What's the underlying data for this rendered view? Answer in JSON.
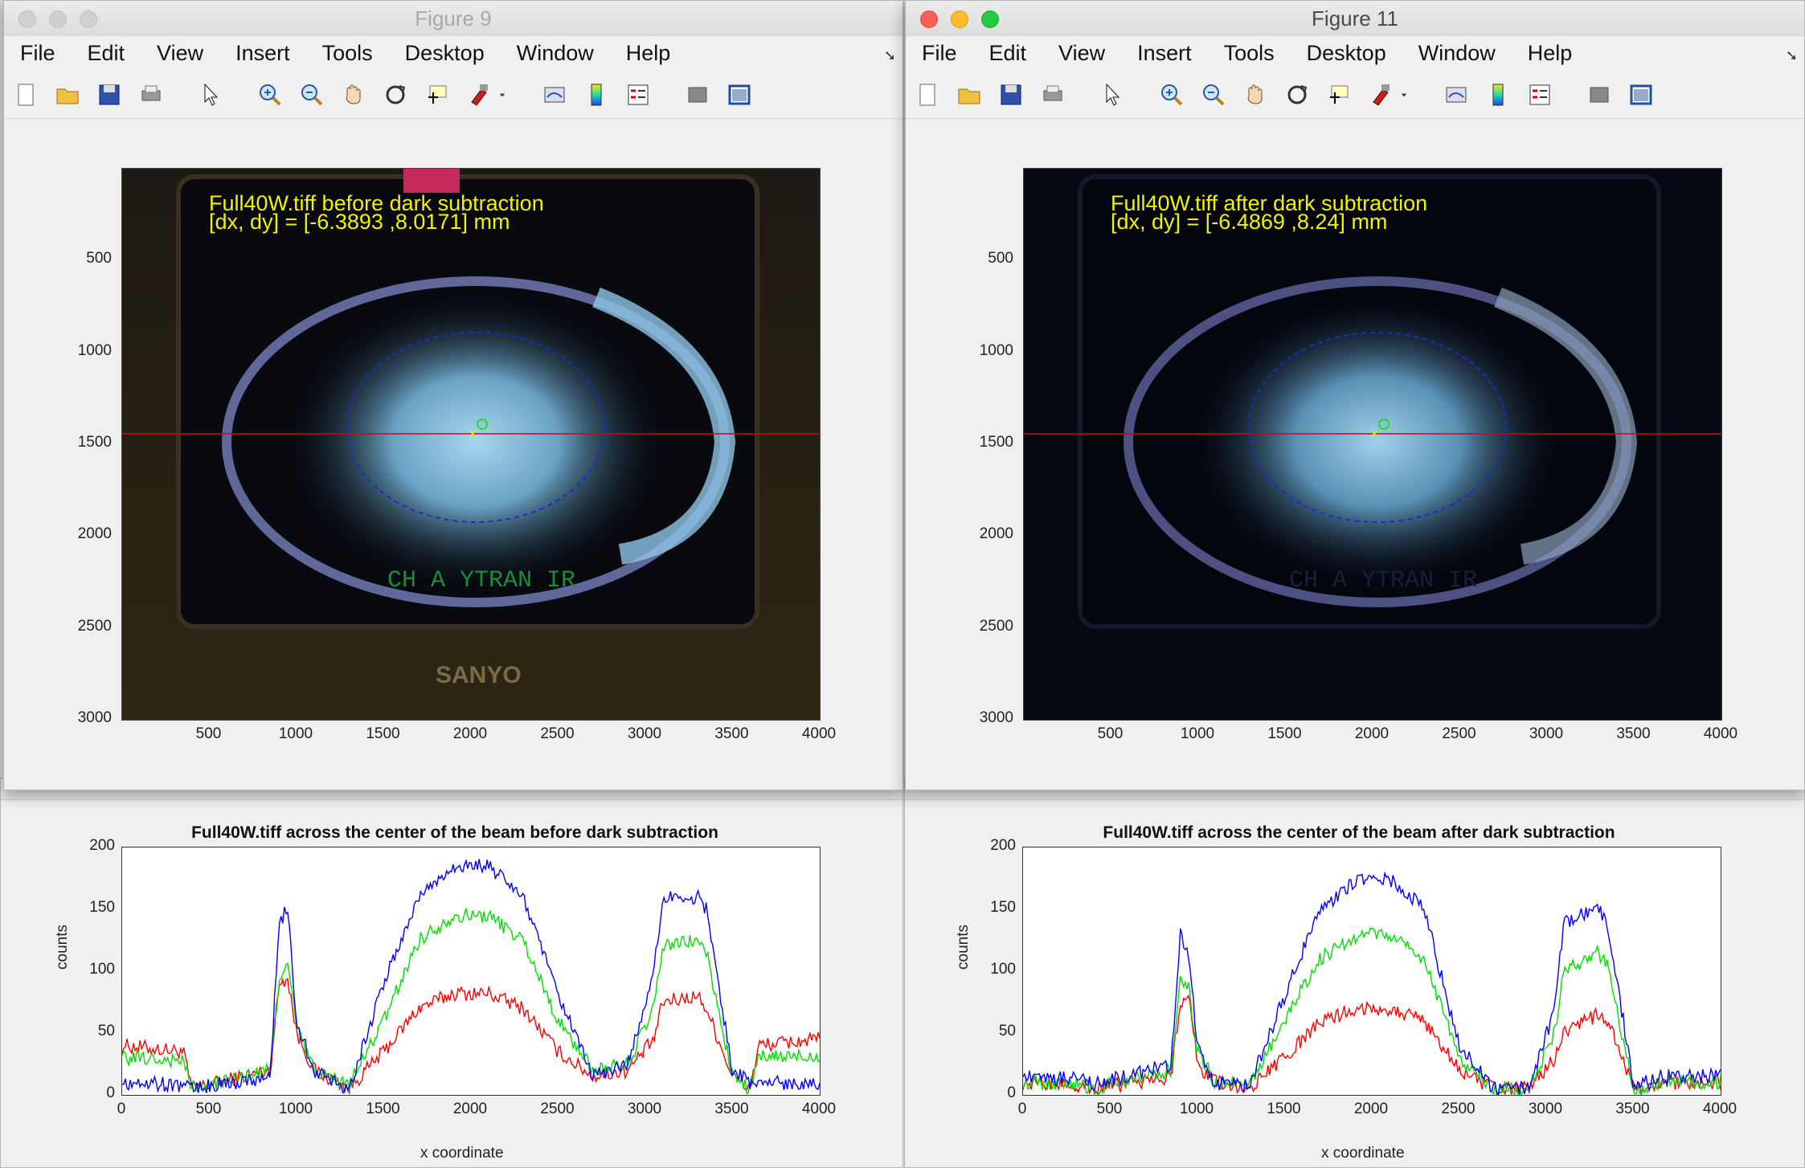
{
  "windows": [
    {
      "title": "Figure 9",
      "active": false,
      "annotation_line1": "Full40W.tiff before dark subtraction",
      "annotation_line2": "[dx, dy] = [-6.3893 ,8.0171] mm",
      "overlay_text": "CH A YTRAN IR",
      "brand_text": "SANYO",
      "plot_title": "Full40W.tiff across the center of the beam before dark subtraction"
    },
    {
      "title": "Figure 11",
      "active": true,
      "annotation_line1": "Full40W.tiff after dark subtraction",
      "annotation_line2": "[dx, dy] = [-6.4869 ,8.24] mm",
      "overlay_text": "CH A YTRAN IR",
      "brand_text": "",
      "plot_title": "Full40W.tiff across the center of the beam after dark subtraction"
    }
  ],
  "menu": [
    "File",
    "Edit",
    "View",
    "Insert",
    "Tools",
    "Desktop",
    "Window",
    "Help"
  ],
  "toolbar_icons": [
    "new-figure-icon",
    "open-file-icon",
    "save-icon",
    "print-icon",
    "pointer-icon",
    "zoom-in-icon",
    "zoom-out-icon",
    "pan-icon",
    "rotate-3d-icon",
    "data-cursor-icon",
    "brush-icon",
    "brush-dropdown-icon",
    "link-plot-icon",
    "colorbar-icon",
    "legend-icon",
    "hide-plot-tools-icon",
    "show-plot-tools-icon"
  ],
  "image_axes": {
    "x_ticks": [
      "500",
      "1000",
      "1500",
      "2000",
      "2500",
      "3000",
      "3500",
      "4000"
    ],
    "y_ticks": [
      "500",
      "1000",
      "1500",
      "2000",
      "2500",
      "3000"
    ]
  },
  "profile_axes": {
    "x_ticks": [
      "0",
      "500",
      "1000",
      "1500",
      "2000",
      "2500",
      "3000",
      "3500",
      "4000"
    ],
    "y_ticks": [
      "0",
      "50",
      "100",
      "150",
      "200"
    ],
    "xlabel": "x coordinate",
    "ylabel": "counts"
  },
  "chart_data": [
    {
      "type": "line",
      "title": "Full40W.tiff across the center of the beam before dark subtraction",
      "xlabel": "x coordinate",
      "ylabel": "counts",
      "xlim": [
        0,
        4000
      ],
      "ylim": [
        0,
        200
      ],
      "x": [
        0,
        350,
        400,
        850,
        900,
        950,
        1000,
        1100,
        1300,
        1500,
        1700,
        1900,
        2100,
        2300,
        2500,
        2700,
        2900,
        3050,
        3100,
        3300,
        3350,
        3500,
        3600,
        3650,
        4000
      ],
      "series": [
        {
          "color": "#ff0000",
          "values": [
            40,
            35,
            5,
            20,
            90,
            95,
            50,
            20,
            5,
            35,
            70,
            82,
            82,
            70,
            35,
            15,
            20,
            45,
            75,
            80,
            70,
            15,
            5,
            40,
            45
          ]
        },
        {
          "color": "#00e000",
          "values": [
            30,
            28,
            5,
            20,
            95,
            105,
            55,
            20,
            8,
            60,
            125,
            145,
            145,
            125,
            60,
            20,
            25,
            70,
            120,
            125,
            115,
            15,
            5,
            30,
            32
          ]
        },
        {
          "color": "#0000ff",
          "values": [
            10,
            8,
            5,
            15,
            140,
            150,
            60,
            20,
            5,
            90,
            160,
            185,
            185,
            160,
            80,
            15,
            25,
            100,
            160,
            160,
            150,
            20,
            10,
            10,
            10
          ]
        }
      ]
    },
    {
      "type": "line",
      "title": "Full40W.tiff across the center of the beam after dark subtraction",
      "xlabel": "x coordinate",
      "ylabel": "counts",
      "xlim": [
        0,
        4000
      ],
      "ylim": [
        0,
        200
      ],
      "x": [
        0,
        350,
        400,
        850,
        900,
        950,
        1000,
        1100,
        1300,
        1500,
        1700,
        1900,
        2100,
        2300,
        2500,
        2700,
        2900,
        3050,
        3100,
        3300,
        3350,
        3500,
        3600,
        3650,
        4000
      ],
      "series": [
        {
          "color": "#ff0000",
          "values": [
            10,
            8,
            5,
            15,
            75,
            80,
            25,
            10,
            5,
            30,
            58,
            70,
            70,
            60,
            20,
            5,
            5,
            30,
            50,
            65,
            60,
            5,
            5,
            10,
            10
          ]
        },
        {
          "color": "#00e000",
          "values": [
            10,
            8,
            5,
            20,
            95,
            85,
            35,
            10,
            8,
            60,
            110,
            128,
            130,
            110,
            30,
            5,
            5,
            50,
            100,
            115,
            105,
            5,
            5,
            10,
            10
          ]
        },
        {
          "color": "#0000ff",
          "values": [
            15,
            12,
            8,
            25,
            130,
            115,
            40,
            10,
            8,
            80,
            150,
            172,
            175,
            150,
            40,
            5,
            5,
            70,
            140,
            150,
            140,
            10,
            10,
            15,
            15
          ]
        }
      ]
    }
  ]
}
